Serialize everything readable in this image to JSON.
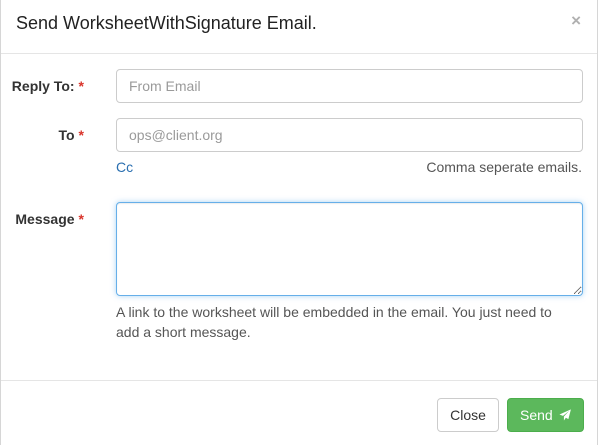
{
  "modal": {
    "title": "Send WorksheetWithSignature Email.",
    "close_glyph": "×"
  },
  "form": {
    "reply_to": {
      "label": "Reply To:",
      "required_mark": "*",
      "value": "",
      "placeholder": "From Email"
    },
    "to": {
      "label": "To",
      "required_mark": "*",
      "value": "",
      "placeholder": "ops@client.org",
      "cc_link": "Cc",
      "help": "Comma seperate emails."
    },
    "message": {
      "label": "Message",
      "required_mark": "*",
      "value": "",
      "help": "A link to the worksheet will be embedded in the email. You just need to add a short message."
    }
  },
  "footer": {
    "close_label": "Close",
    "send_label": "Send",
    "send_icon": "paper-plane-icon"
  },
  "colors": {
    "send_button": "#5cb85c",
    "required_mark": "#d9342b",
    "link": "#2a6fb0",
    "focus_border": "#66afe9"
  }
}
